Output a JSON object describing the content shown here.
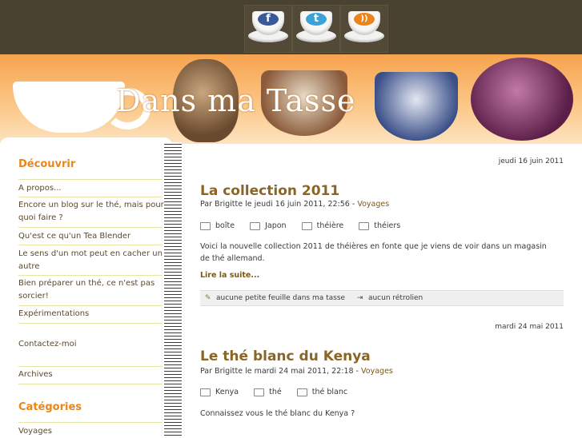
{
  "header": {
    "site_title": "Dans ma Tasse",
    "social": [
      {
        "name": "facebook",
        "letter": "f",
        "color": "#3b5998"
      },
      {
        "name": "twitter",
        "letter": "t",
        "color": "#3ba3d6"
      },
      {
        "name": "rss",
        "letter": "))",
        "color": "#e8861c"
      }
    ]
  },
  "sidebar": {
    "discover_heading": "Découvrir",
    "links": [
      "A propos...",
      "Encore un blog sur le thé, mais pour quoi faire ?",
      "Qu'est ce qu'un Tea Blender",
      "Le sens d'un mot peut en cacher un autre",
      "Bien préparer un thé, ce n'est pas sorcier!",
      "Expérimentations"
    ],
    "contact": "Contactez-moi",
    "archives": "Archives",
    "categories_heading": "Catégories",
    "category_first": "Voyages"
  },
  "posts": [
    {
      "date": "jeudi 16 juin 2011",
      "title": "La collection 2011",
      "byline": "Par Brigitte le jeudi 16 juin 2011, 22:56 - ",
      "category": "Voyages",
      "tags": [
        "boîte",
        "Japon",
        "théière",
        "théiers"
      ],
      "excerpt": "Voici la nouvelle collection 2011 de théières en fonte que je viens de voir dans un magasin de thé allemand.",
      "read_more": "Lire la suite...",
      "comments": "aucune petite feuille dans ma tasse",
      "trackbacks": "aucun rétrolien"
    },
    {
      "date": "mardi 24 mai 2011",
      "title": "Le thé blanc du Kenya",
      "byline": "Par Brigitte le mardi 24 mai 2011, 22:18 - ",
      "category": "Voyages",
      "tags": [
        "Kenya",
        "thé",
        "thé blanc"
      ],
      "excerpt": "Connaissez vous le thé blanc du Kenya ?"
    }
  ]
}
